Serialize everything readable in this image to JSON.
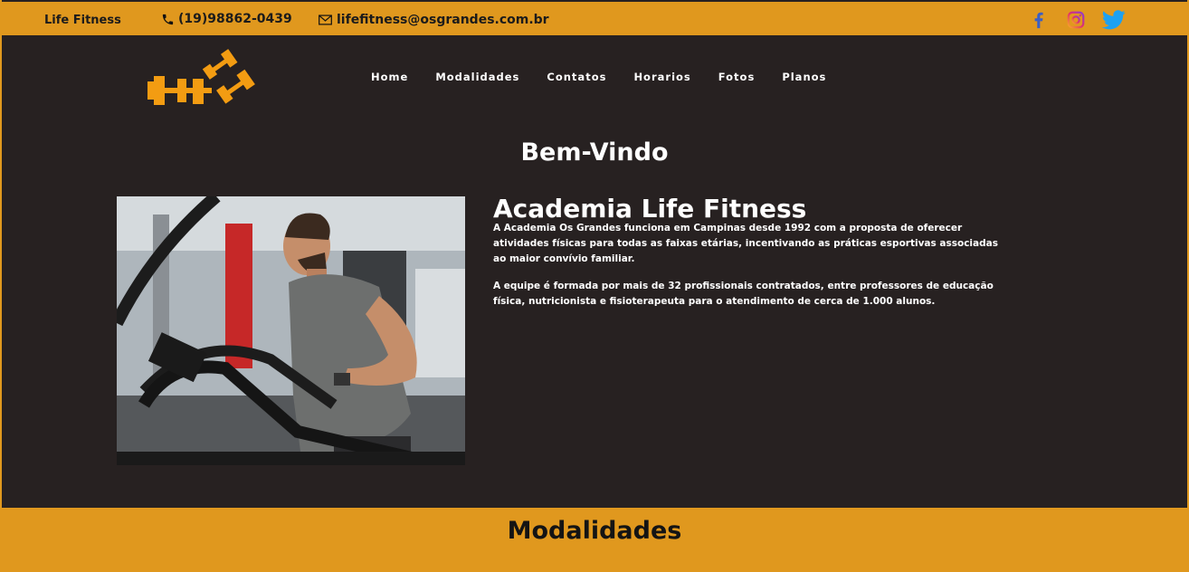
{
  "topbar": {
    "brand": "Life Fitness",
    "phone": "(19)98862-0439",
    "email": "lifefitness@osgrandes.com.br",
    "social": [
      "facebook-icon",
      "instagram-icon",
      "twitter-icon"
    ]
  },
  "nav": {
    "items": [
      "Home",
      "Modalidades",
      "Contatos",
      "Horarios",
      "Fotos",
      "Planos"
    ]
  },
  "hero": {
    "welcome": "Bem-Vindo",
    "title": "Academia Life Fitness",
    "paragraph1": "A Academia Os Grandes funciona em Campinas desde 1992 com a proposta de oferecer atividades físicas para todas as faixas etárias, incentivando as práticas esportivas associadas ao maior convívio familiar.",
    "paragraph2": "A equipe é formada por mais de 32 profissionais contratados, entre professores de educação física, nutricionista e fisioterapeuta para o atendimento de cerca de 1.000 alunos."
  },
  "modalidades": {
    "title": "Modalidades"
  },
  "colors": {
    "accent": "#e0981e",
    "background": "#272121",
    "text_light": "#ffffff",
    "text_dark": "#1b1b1b"
  }
}
